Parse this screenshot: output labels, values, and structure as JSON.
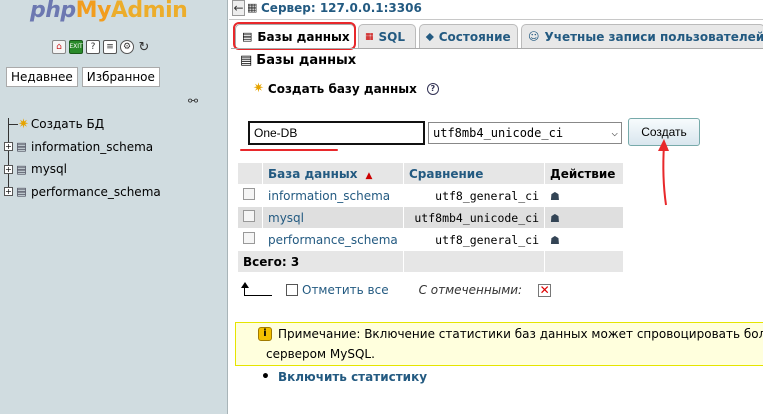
{
  "nav": {
    "logo_php": "php",
    "logo_my": "My",
    "logo_admin": "Admin",
    "icons": [
      "home-icon",
      "exit-icon",
      "help-icon",
      "docs-icon",
      "settings-icon",
      "reload-icon"
    ],
    "tabs": [
      "Недавнее",
      "Избранное"
    ],
    "tree": [
      {
        "label": "Создать БД",
        "icon": "new-db-icon"
      },
      {
        "label": "information_schema",
        "icon": "database-icon"
      },
      {
        "label": "mysql",
        "icon": "database-icon"
      },
      {
        "label": "performance_schema",
        "icon": "database-icon"
      }
    ]
  },
  "topbar": {
    "server_label": "Сервер: 127.0.0.1:3306"
  },
  "tabs": [
    {
      "label": "Базы данных",
      "icon": "database-icon",
      "active": true
    },
    {
      "label": "SQL",
      "icon": "sql-icon",
      "active": false
    },
    {
      "label": "Состояние",
      "icon": "status-icon",
      "active": false
    },
    {
      "label": "Учетные записи пользователей",
      "icon": "users-icon",
      "active": false
    }
  ],
  "main": {
    "page_title": "Базы данных",
    "create_title": "Создать базу данных",
    "db_name_value": "One-DB",
    "collation_value": "utf8mb4_unicode_ci",
    "create_button": "Создать",
    "table": {
      "headers": {
        "name": "База данных",
        "collation": "Сравнение",
        "action": "Действие"
      },
      "rows": [
        {
          "name": "information_schema",
          "collation": "utf8_general_ci"
        },
        {
          "name": "mysql",
          "collation": "utf8mb4_unicode_ci"
        },
        {
          "name": "performance_schema",
          "collation": "utf8_general_ci"
        }
      ],
      "total": "Всего: 3"
    },
    "check_all": "Отметить все",
    "with_selected": "С отмеченными:",
    "notice_line1": "Примечание: Включение статистики баз данных может спровоцировать большо",
    "notice_line2": "сервером MySQL.",
    "enable_stats": "Включить статистику"
  },
  "colors": {
    "accent_red": "#e8282b",
    "link_blue": "#235a81",
    "nav_bg": "#d0dce0",
    "notice_bg": "#ffffdd"
  }
}
